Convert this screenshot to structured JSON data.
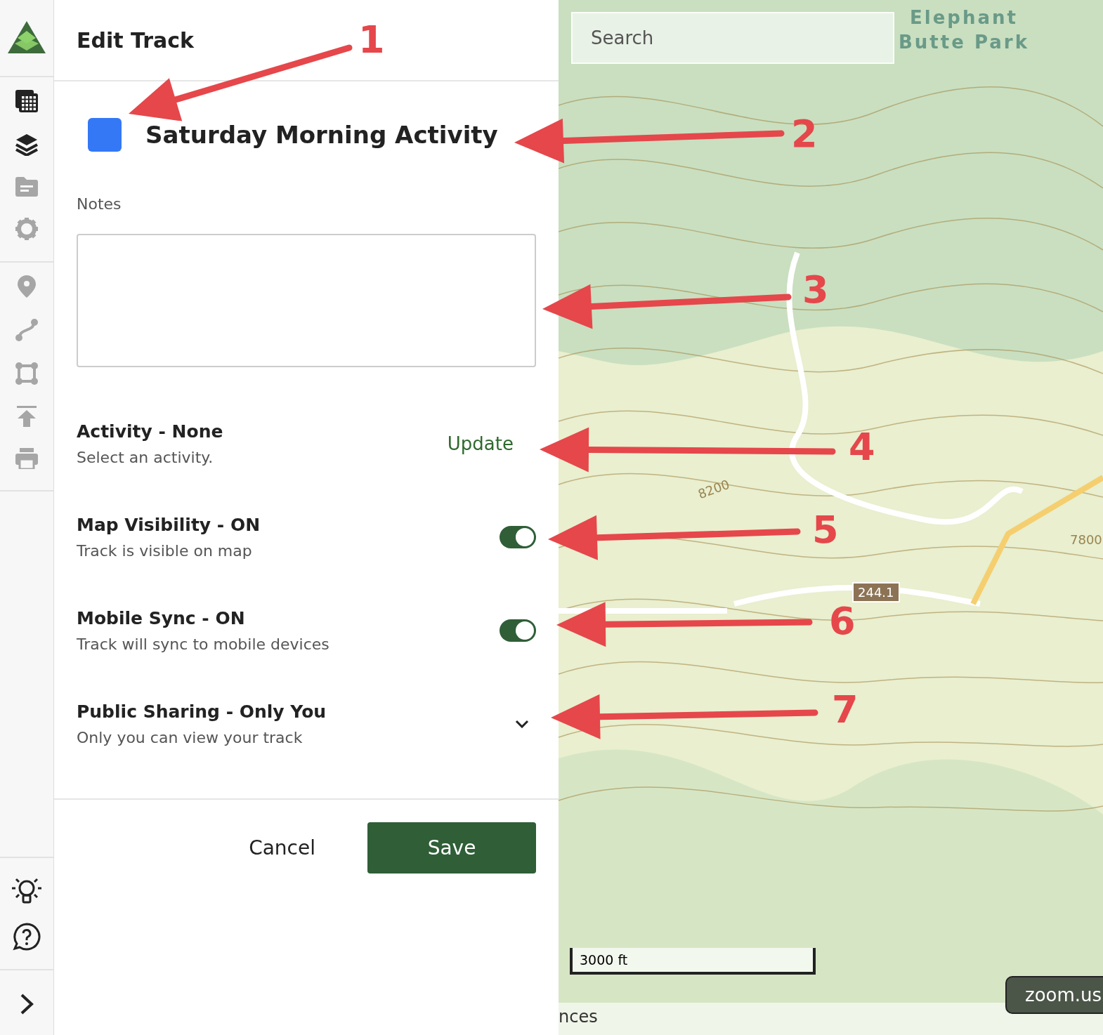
{
  "header": {
    "title": "Edit Track"
  },
  "track": {
    "color": "#3478f6",
    "name": "Saturday Morning Activity"
  },
  "notes": {
    "label": "Notes"
  },
  "settings": [
    {
      "kind": "action",
      "title": "Activity - None",
      "subtitle": "Select an activity.",
      "action": "Update"
    },
    {
      "kind": "toggle",
      "title": "Map Visibility - ON",
      "subtitle": "Track is visible on map",
      "on": true
    },
    {
      "kind": "toggle",
      "title": "Mobile Sync - ON",
      "subtitle": "Track will sync to mobile devices",
      "on": true
    },
    {
      "kind": "dropdown",
      "title": "Public Sharing - Only You",
      "subtitle": "Only you can view your track",
      "expanded": false
    }
  ],
  "buttons": {
    "cancel": "Cancel",
    "save": "Save"
  },
  "map": {
    "search_placeholder": "Search",
    "park_label": "Elephant Butte Park",
    "elevation_labels": [
      "8200",
      "7800"
    ],
    "road_label": "244.1",
    "scale": "3000 ft",
    "bottom_text": "nces",
    "tooltip": "zoom.us"
  },
  "annotations": [
    {
      "label": "1"
    },
    {
      "label": "2"
    },
    {
      "label": "3"
    },
    {
      "label": "4"
    },
    {
      "label": "5"
    },
    {
      "label": "6"
    },
    {
      "label": "7"
    }
  ]
}
